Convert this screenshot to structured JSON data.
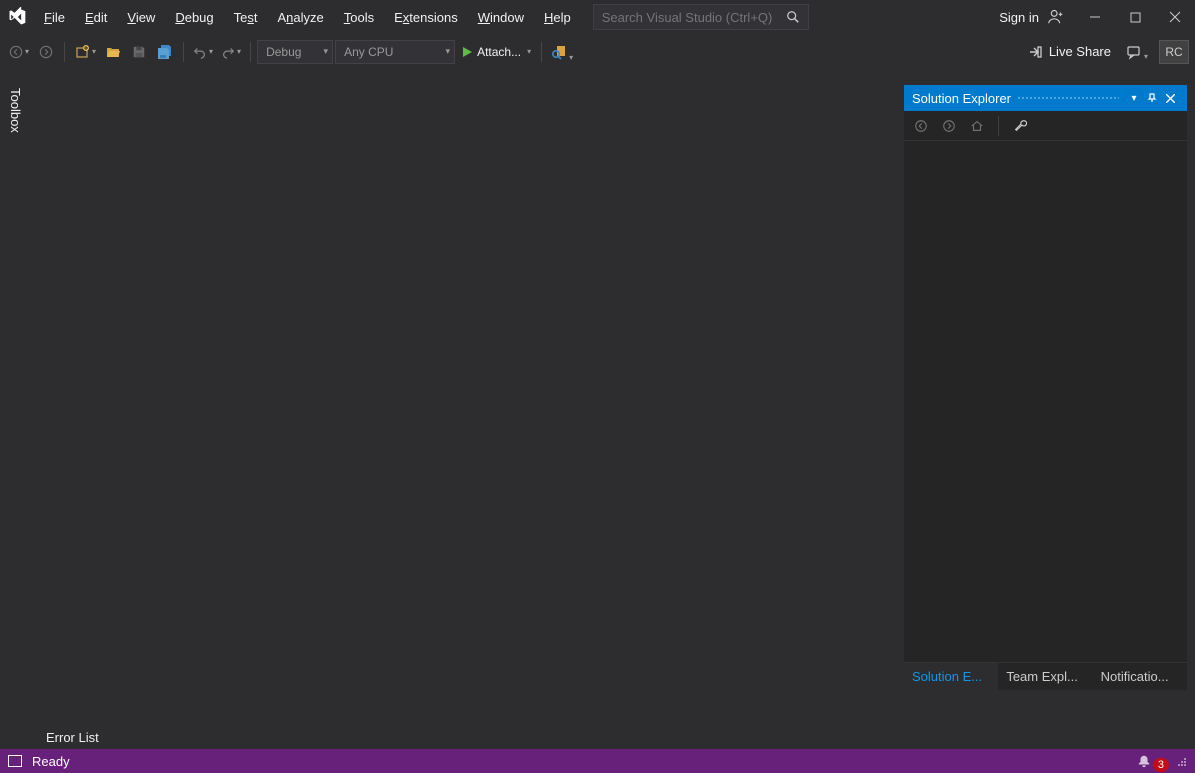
{
  "menu": {
    "file": "File",
    "edit": "Edit",
    "view": "View",
    "debug": "Debug",
    "test": "Test",
    "analyze": "Analyze",
    "tools": "Tools",
    "extensions": "Extensions",
    "window": "Window",
    "help": "Help"
  },
  "search": {
    "placeholder": "Search Visual Studio (Ctrl+Q)"
  },
  "signin": {
    "label": "Sign in"
  },
  "toolbar": {
    "config": "Debug",
    "platform": "Any CPU",
    "attach": "Attach...",
    "liveshare": "Live Share",
    "rc": "RC"
  },
  "toolbox": {
    "tab": "Toolbox"
  },
  "solutionExplorer": {
    "title": "Solution Explorer",
    "tabs": {
      "solution": "Solution E...",
      "team": "Team Expl...",
      "notifications": "Notificatio..."
    }
  },
  "bottom": {
    "errorlist": "Error List"
  },
  "status": {
    "ready": "Ready",
    "notifications": "3"
  }
}
